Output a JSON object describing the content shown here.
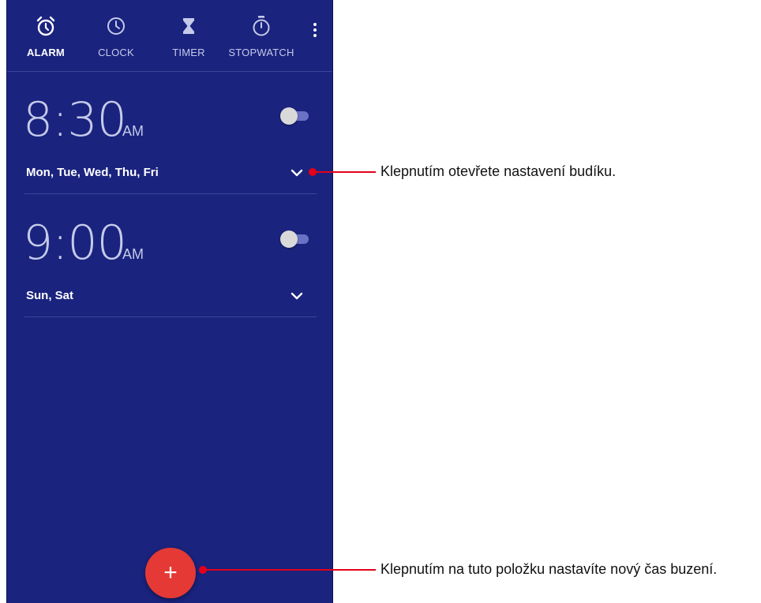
{
  "tabs": [
    {
      "label": "ALARM",
      "icon": "alarm-icon",
      "active": true
    },
    {
      "label": "CLOCK",
      "icon": "clock-icon",
      "active": false
    },
    {
      "label": "TIMER",
      "icon": "hourglass-icon",
      "active": false
    },
    {
      "label": "STOPWATCH",
      "icon": "stopwatch-icon",
      "active": false
    }
  ],
  "alarms": [
    {
      "time": "8:30",
      "ampm": "AM",
      "days": "Mon, Tue, Wed, Thu, Fri",
      "enabled": false
    },
    {
      "time": "9:00",
      "ampm": "AM",
      "days": "Sun, Sat",
      "enabled": false
    }
  ],
  "fab": {
    "label": "+"
  },
  "callouts": {
    "expand": "Klepnutím otevřete nastavení budíku.",
    "add": "Klepnutím na tuto položku nastavíte nový čas buzení."
  },
  "colors": {
    "background": "#1a237e",
    "accent": "#e53935",
    "callout": "#e4001b"
  }
}
